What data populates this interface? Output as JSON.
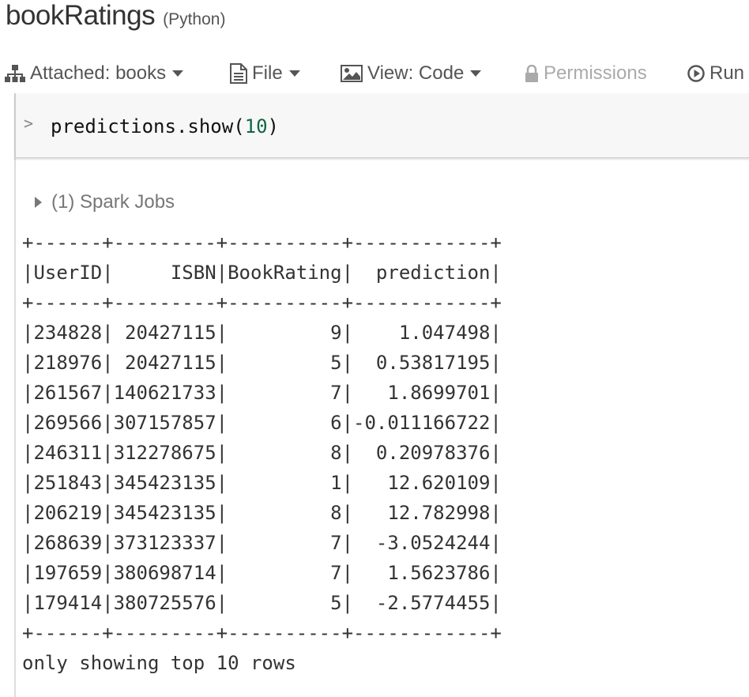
{
  "notebook": {
    "title": "bookRatings",
    "language": "(Python)"
  },
  "toolbar": {
    "attached_label": "Attached: books",
    "file_label": "File",
    "view_label": "View: Code",
    "permissions_label": "Permissions",
    "run_label": "Run"
  },
  "cell": {
    "prompt": ">",
    "code_prefix": "predictions.show(",
    "code_arg": "10",
    "code_suffix": ")"
  },
  "spark_jobs": {
    "label": "(1) Spark Jobs"
  },
  "output": {
    "lines": [
      "+------+---------+----------+------------+",
      "|UserID|     ISBN|BookRating|  prediction|",
      "+------+---------+----------+------------+",
      "|234828| 20427115|         9|    1.047498|",
      "|218976| 20427115|         5|  0.53817195|",
      "|261567|140621733|         7|   1.8699701|",
      "|269566|307157857|         6|-0.011166722|",
      "|246311|312278675|         8|  0.20978376|",
      "|251843|345423135|         1|   12.620109|",
      "|206219|345423135|         8|   12.782998|",
      "|268639|373123337|         7|  -3.0524244|",
      "|197659|380698714|         7|   1.5623786|",
      "|179414|380725576|         5|  -2.5774455|",
      "+------+---------+----------+------------+",
      "only showing top 10 rows"
    ]
  }
}
